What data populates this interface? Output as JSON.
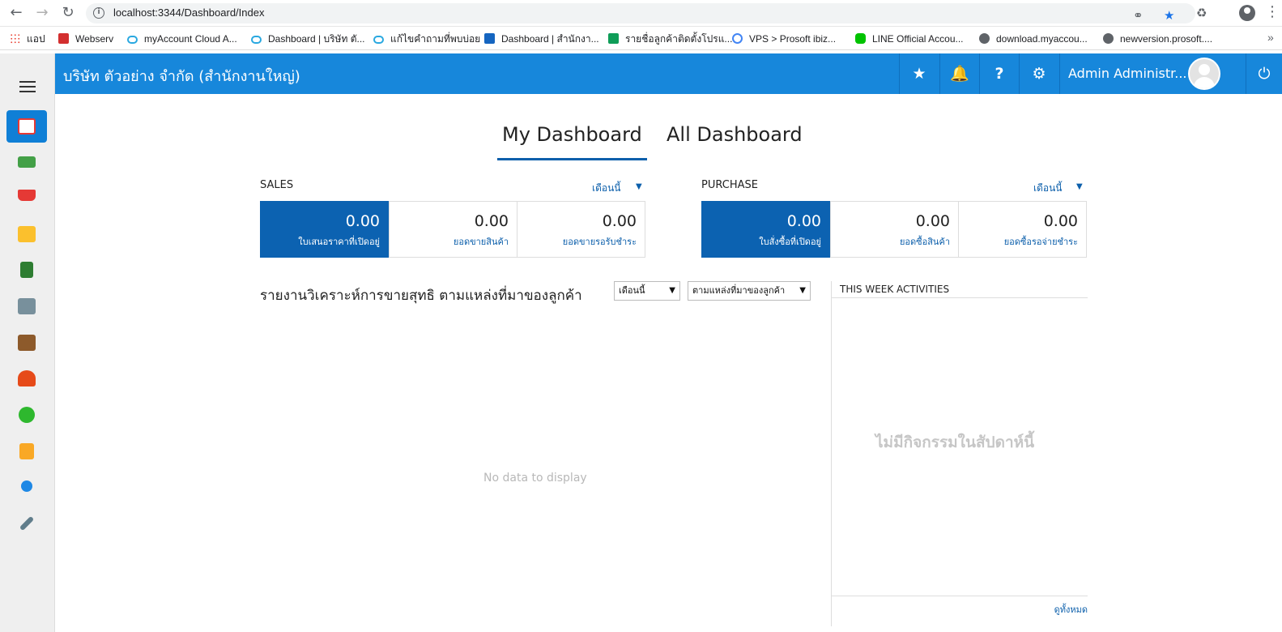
{
  "browser": {
    "url": "localhost:3344/Dashboard/Index",
    "bookmarks": [
      {
        "label": "แอป",
        "icon": "apps-grid-icon",
        "color": "#e94235"
      },
      {
        "label": "Webserv",
        "icon": "shield-icon",
        "color": "#d32f2f"
      },
      {
        "label": "myAccount Cloud A...",
        "icon": "cloud-icon",
        "color": "#29a8e0"
      },
      {
        "label": "Dashboard | บริษัท ตั...",
        "icon": "cloud-icon",
        "color": "#29a8e0"
      },
      {
        "label": "แก้ไขคำถามที่พบบ่อย",
        "icon": "cloud-icon",
        "color": "#29a8e0"
      },
      {
        "label": "Dashboard | สำนักงา...",
        "icon": "info-icon",
        "color": "#1565c0"
      },
      {
        "label": "รายชื่อลูกค้าติดตั้งโปรแ...",
        "icon": "sheets-icon",
        "color": "#0f9d58"
      },
      {
        "label": "VPS > Prosoft ibiz...",
        "icon": "google-icon",
        "color": "#4285f4"
      },
      {
        "label": "LINE Official Accou...",
        "icon": "line-icon",
        "color": "#00c300"
      },
      {
        "label": "download.myaccou...",
        "icon": "globe-icon",
        "color": "#5f6368"
      },
      {
        "label": "newversion.prosoft....",
        "icon": "globe-icon",
        "color": "#5f6368"
      }
    ]
  },
  "header": {
    "company": "บริษัท ตัวอย่าง จำกัด (สำนักงานใหญ่)",
    "user_name": "Admin Administr...",
    "accent": "#1787db"
  },
  "sidebar": {
    "items": [
      {
        "icon": "dashboard-monitor-icon",
        "color": "#e53935",
        "active": true
      },
      {
        "icon": "cash-icon",
        "color": "#43a047"
      },
      {
        "icon": "shopping-cart-icon",
        "color": "#e53935"
      },
      {
        "icon": "box-icon",
        "color": "#fbc02d"
      },
      {
        "icon": "book-icon",
        "color": "#2e7d32"
      },
      {
        "icon": "bank-icon",
        "color": "#78909c"
      },
      {
        "icon": "wallet-icon",
        "color": "#8d5a2b"
      },
      {
        "icon": "employee-icon",
        "color": "#e64a19"
      },
      {
        "icon": "check-circle-icon",
        "color": "#2eb82e"
      },
      {
        "icon": "report-list-icon",
        "color": "#f9a825"
      },
      {
        "icon": "search-zoom-icon",
        "color": "#1e88e5"
      },
      {
        "icon": "tools-icon",
        "color": "#607d8b"
      }
    ]
  },
  "tabs": {
    "my_dashboard": "My Dashboard",
    "all_dashboard": "All Dashboard"
  },
  "sales": {
    "title": "SALES",
    "period": "เดือนนี้",
    "kpis": [
      {
        "value": "0.00",
        "label": "ใบเสนอราคาที่เปิดอยู่"
      },
      {
        "value": "0.00",
        "label": "ยอดขายสินค้า"
      },
      {
        "value": "0.00",
        "label": "ยอดขายรอรับชำระ"
      }
    ]
  },
  "purchase": {
    "title": "PURCHASE",
    "period": "เดือนนี้",
    "kpis": [
      {
        "value": "0.00",
        "label": "ใบสั่งซื้อที่เปิดอยู่"
      },
      {
        "value": "0.00",
        "label": "ยอดซื้อสินค้า"
      },
      {
        "value": "0.00",
        "label": "ยอดซื้อรอจ่ายชำระ"
      }
    ]
  },
  "report": {
    "title": "รายงานวิเคราะห์การขายสุทธิ ตามแหล่งที่มาของลูกค้า",
    "period_select": "เดือนนี้",
    "group_select": "ตามแหล่งที่มาของลูกค้า",
    "empty_text": "No data to display"
  },
  "activities": {
    "title": "THIS WEEK ACTIVITIES",
    "empty_text": "ไม่มีกิจกรรมในสัปดาห์นี้",
    "view_all": "ดูทั้งหมด"
  }
}
